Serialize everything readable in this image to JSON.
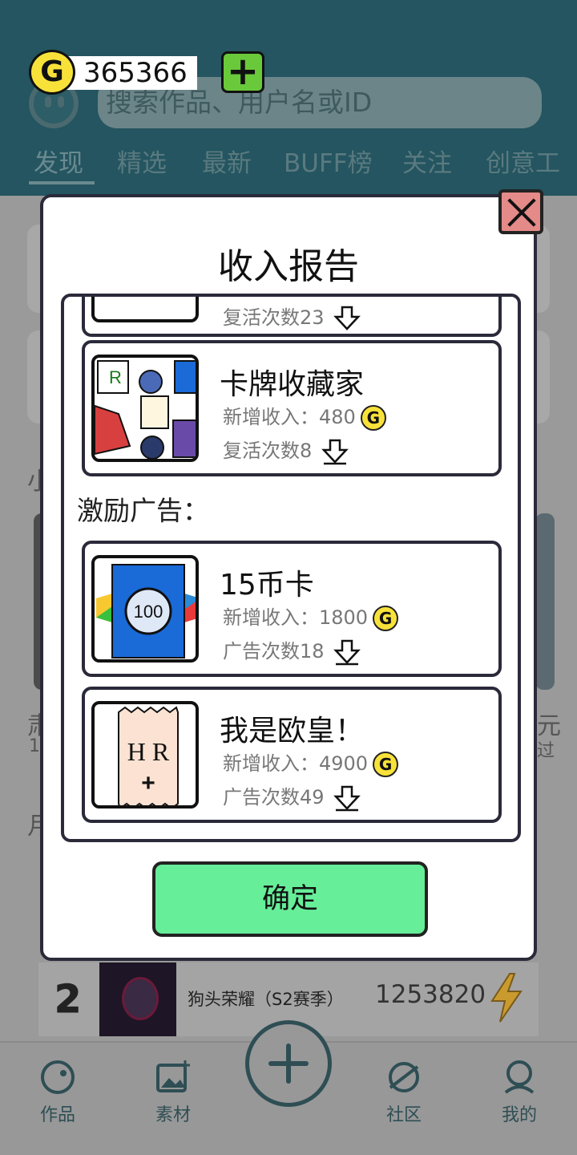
{
  "header": {
    "search_placeholder": "搜索作品、用户名或ID",
    "tabs": [
      "发现",
      "精选",
      "最新",
      "BUFF榜",
      "关注",
      "创意工"
    ]
  },
  "coins": {
    "symbol": "G",
    "amount": "365366"
  },
  "background_list": {
    "side_chars": [
      "小",
      "肃",
      "1",
      "元",
      "过",
      "月"
    ]
  },
  "leaderboard_row": {
    "rank": "2",
    "title": "狗头荣耀（S2赛季）",
    "score": "1253820"
  },
  "bottom_nav": {
    "items": [
      {
        "label": "作品",
        "icon": "palette-icon"
      },
      {
        "label": "素材",
        "icon": "image-add-icon"
      },
      {
        "label": "社区",
        "icon": "planet-icon"
      },
      {
        "label": "我的",
        "icon": "profile-icon"
      }
    ]
  },
  "modal": {
    "title": "收入报告",
    "confirm_label": "确定",
    "section_ads_label": "激励广告：",
    "items": [
      {
        "name": "",
        "line1": "",
        "line2": "复活次数23"
      },
      {
        "name": "卡牌收藏家",
        "income_label": "新增收入：480",
        "count_label": "复活次数8"
      },
      {
        "name": "15币卡",
        "income_label": "新增收入：1800",
        "count_label": "广告次数18"
      },
      {
        "name": "我是欧皇！",
        "income_label": "新增收入：4900",
        "count_label": "广告次数49"
      }
    ],
    "thumb_texts": {
      "coin_card": "100",
      "card_hr": "H R",
      "card_plus": "+"
    }
  }
}
